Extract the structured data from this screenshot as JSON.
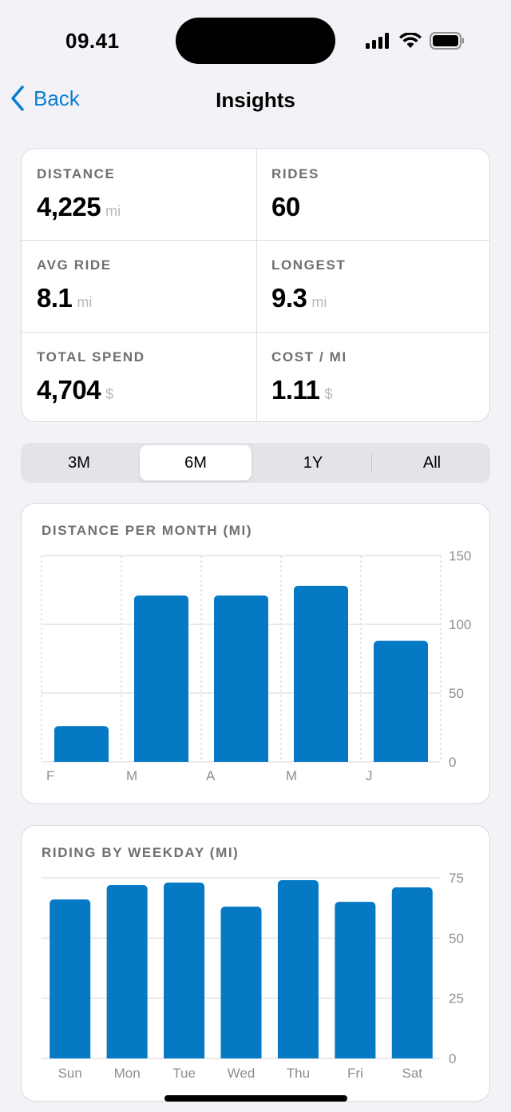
{
  "status_bar": {
    "time": "09.41"
  },
  "nav": {
    "back_label": "Back",
    "title": "Insights"
  },
  "stats": [
    {
      "label": "DISTANCE",
      "value": "4,225",
      "unit": "mi"
    },
    {
      "label": "RIDES",
      "value": "60",
      "unit": ""
    },
    {
      "label": "AVG RIDE",
      "value": "8.1",
      "unit": "mi"
    },
    {
      "label": "LONGEST",
      "value": "9.3",
      "unit": "mi"
    },
    {
      "label": "TOTAL SPEND",
      "value": "4,704",
      "unit": "$"
    },
    {
      "label": "COST / MI",
      "value": "1.11",
      "unit": "$"
    }
  ],
  "range_selector": {
    "options": [
      "3M",
      "6M",
      "1Y",
      "All"
    ],
    "selected": "6M"
  },
  "colors": {
    "accent": "#0a7fd0",
    "bar": "#0579c4",
    "background": "#f2f2f7"
  },
  "chart_data": [
    {
      "type": "bar",
      "title": "DISTANCE PER MONTH (MI)",
      "categories": [
        "F",
        "M",
        "A",
        "M",
        "J"
      ],
      "values": [
        26,
        121,
        121,
        128,
        88
      ],
      "ylim": [
        0,
        150
      ],
      "yticks": [
        0,
        50,
        100,
        150
      ],
      "grid": true,
      "y_axis_side": "right"
    },
    {
      "type": "bar",
      "title": "RIDING BY WEEKDAY (MI)",
      "categories": [
        "Sun",
        "Mon",
        "Tue",
        "Wed",
        "Thu",
        "Fri",
        "Sat"
      ],
      "values": [
        66,
        72,
        73,
        63,
        74,
        65,
        71
      ],
      "ylim": [
        0,
        75
      ],
      "yticks": [
        0,
        25,
        50,
        75
      ],
      "grid": true,
      "y_axis_side": "right"
    }
  ]
}
